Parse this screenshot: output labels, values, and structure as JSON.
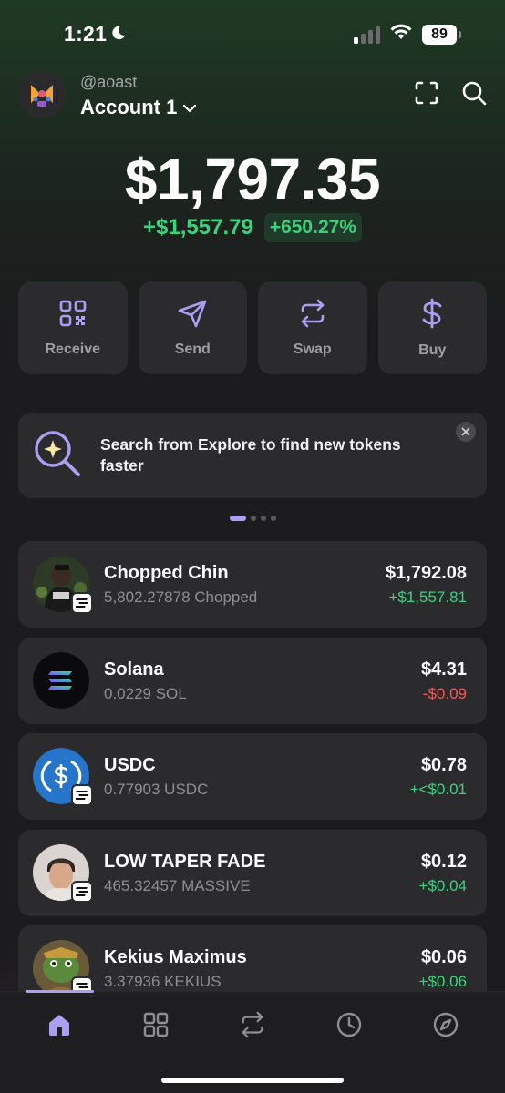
{
  "status": {
    "time": "1:21",
    "battery": "89"
  },
  "header": {
    "username": "@aoast",
    "account_name": "Account 1"
  },
  "portfolio": {
    "balance": "$1,797.35",
    "change_abs": "+$1,557.79",
    "change_pct": "+650.27%"
  },
  "actions": [
    {
      "label": "Receive",
      "icon": "qr-code-icon"
    },
    {
      "label": "Send",
      "icon": "send-icon"
    },
    {
      "label": "Swap",
      "icon": "swap-icon"
    },
    {
      "label": "Buy",
      "icon": "dollar-icon"
    }
  ],
  "banner": {
    "text": "Search from Explore to find new tokens faster"
  },
  "tokens": [
    {
      "name": "Chopped Chin",
      "quantity": "5,802.27878 Chopped",
      "value": "$1,792.08",
      "change": "+$1,557.81",
      "direction": "up"
    },
    {
      "name": "Solana",
      "quantity": "0.0229 SOL",
      "value": "$4.31",
      "change": "-$0.09",
      "direction": "down"
    },
    {
      "name": "USDC",
      "quantity": "0.77903 USDC",
      "value": "$0.78",
      "change": "+<$0.01",
      "direction": "up"
    },
    {
      "name": "LOW TAPER FADE",
      "quantity": "465.32457 MASSIVE",
      "value": "$0.12",
      "change": "+$0.04",
      "direction": "up"
    },
    {
      "name": "Kekius Maximus",
      "quantity": "3.37936 KEKIUS",
      "value": "$0.06",
      "change": "+$0.06",
      "direction": "up"
    }
  ],
  "nav": [
    "home-icon",
    "collectibles-grid-icon",
    "swap-icon",
    "activity-clock-icon",
    "explore-compass-icon"
  ],
  "colors": {
    "accent": "#ab9ff2",
    "positive": "#3ed17d",
    "negative": "#eb5c5c",
    "card": "#2b2b2e"
  }
}
